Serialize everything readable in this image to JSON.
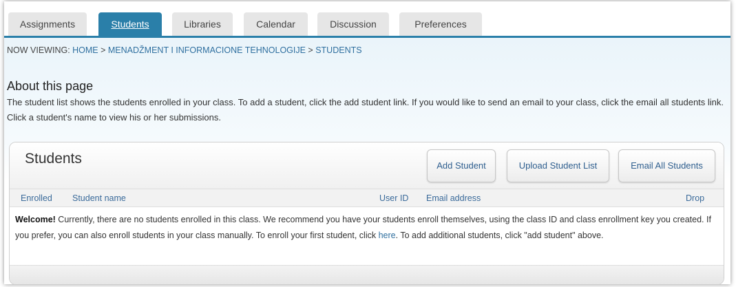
{
  "tabs": [
    {
      "label": "Assignments",
      "active": false
    },
    {
      "label": "Students",
      "active": true
    },
    {
      "label": "Libraries",
      "active": false
    },
    {
      "label": "Calendar",
      "active": false
    },
    {
      "label": "Discussion",
      "active": false
    },
    {
      "label": "Preferences",
      "active": false
    }
  ],
  "breadcrumb": {
    "prefix": "NOW VIEWING: ",
    "home": "HOME",
    "sep1": " > ",
    "course": "MENADŽMENT I INFORMACIONE TEHNOLOGIJE",
    "sep2": " > ",
    "current": "STUDENTS"
  },
  "about": {
    "title": "About this page",
    "text": "The student list shows the students enrolled in your class. To add a student, click the add student link. If you would like to send an email to your class, click the email all students link. Click a student's name to view his or her submissions."
  },
  "panel": {
    "title": "Students",
    "buttons": {
      "add": "Add Student",
      "upload": "Upload Student List",
      "email": "Email All Students"
    },
    "columns": {
      "enrolled": "Enrolled",
      "name": "Student name",
      "user_id": "User ID",
      "email": "Email address",
      "drop": "Drop"
    },
    "welcome": {
      "bold": "Welcome!",
      "text1": " Currently, there are no students enrolled in this class. We recommend you have your students enroll themselves, using the class ID and class enrollment key you created. If you prefer, you can also enroll students in your class manually. To enroll your first student, click ",
      "link": "here",
      "text2": ". To add additional students, click \"add student\" above."
    }
  },
  "colors": {
    "accent": "#2a7fa9",
    "link": "#2f6f9f"
  }
}
